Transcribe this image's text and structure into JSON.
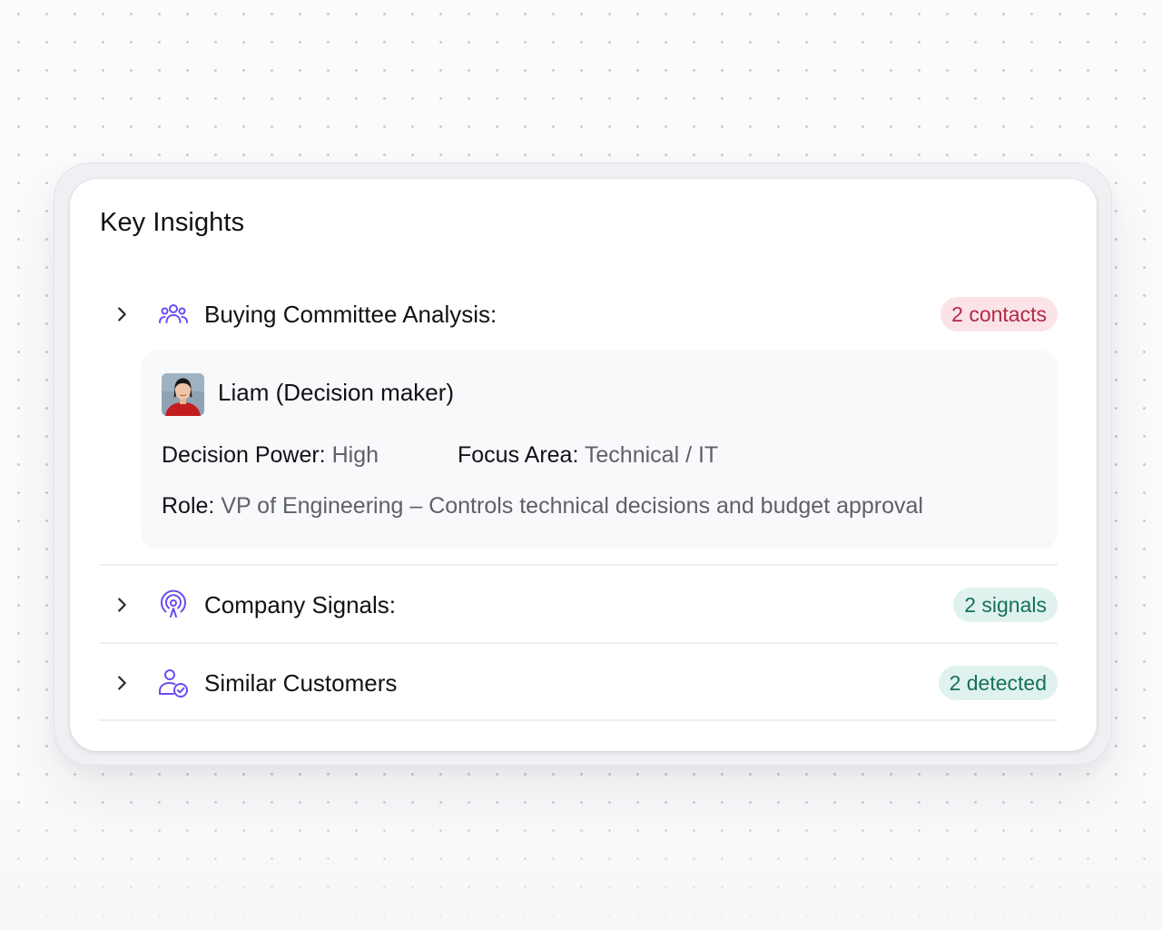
{
  "card": {
    "title": "Key Insights"
  },
  "sections": [
    {
      "title": "Buying Committee Analysis:",
      "icon": "users-group-icon",
      "badge": "2 contacts",
      "badge_color": "#b02a43",
      "expanded": true,
      "contact": {
        "name": "Liam (Decision maker)",
        "decision_power_label": "Decision Power:",
        "decision_power_value": "High",
        "focus_area_label": "Focus Area:",
        "focus_area_value": "Technical / IT",
        "role_label": "Role:",
        "role_value": "VP of Engineering – Controls technical decisions and budget approval"
      }
    },
    {
      "title": "Company Signals:",
      "icon": "broadcast-signal-icon",
      "badge": "2 signals",
      "badge_color": "#16705d",
      "expanded": false
    },
    {
      "title": "Similar Customers",
      "icon": "user-check-icon",
      "badge": "2 detected",
      "badge_color": "#16705d",
      "expanded": false
    }
  ],
  "colors": {
    "accent_icon": "#6c4bf0",
    "chevron": "#2a2b31"
  }
}
